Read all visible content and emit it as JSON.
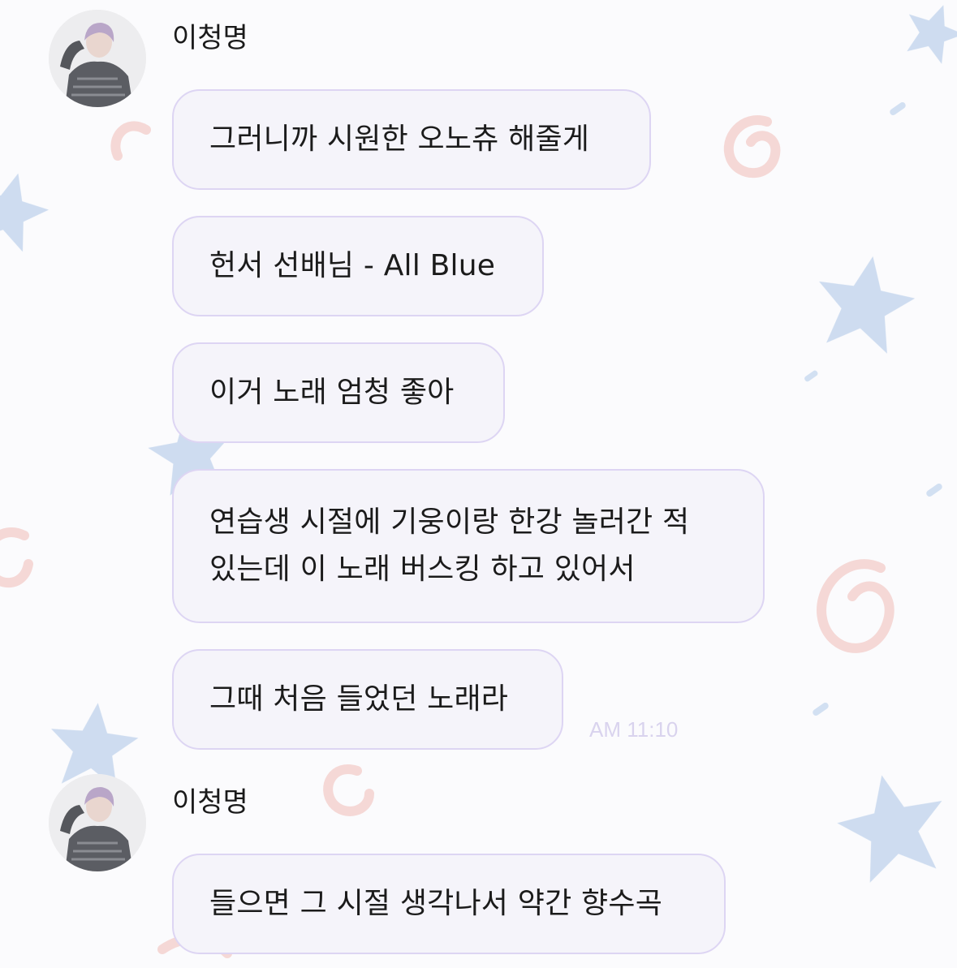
{
  "messages_group_1": {
    "sender": "이청명",
    "bubbles": [
      "그러니까 시원한 오노츄 해줄게",
      "헌서 선배님 - All Blue",
      "이거 노래 엄청 좋아",
      "연습생 시절에 기웅이랑 한강 놀러간 적\n있는데 이 노래 버스킹 하고 있어서",
      "그때 처음 들었던 노래라"
    ],
    "time": "AM 11:10"
  },
  "messages_group_2": {
    "sender": "이청명",
    "bubbles": [
      "들으면 그 시절 생각나서 약간 향수곡"
    ]
  },
  "colors": {
    "bubble_bg": "#f5f4fa",
    "bubble_border": "#ddd5f3",
    "time_text": "#d9d3ee",
    "star_blue": "#a9c4e6",
    "swirl_pink": "#f2c9c4"
  },
  "icons": {
    "avatar": "profile-photo-avatar",
    "background": "star-and-swirl-wallpaper"
  }
}
